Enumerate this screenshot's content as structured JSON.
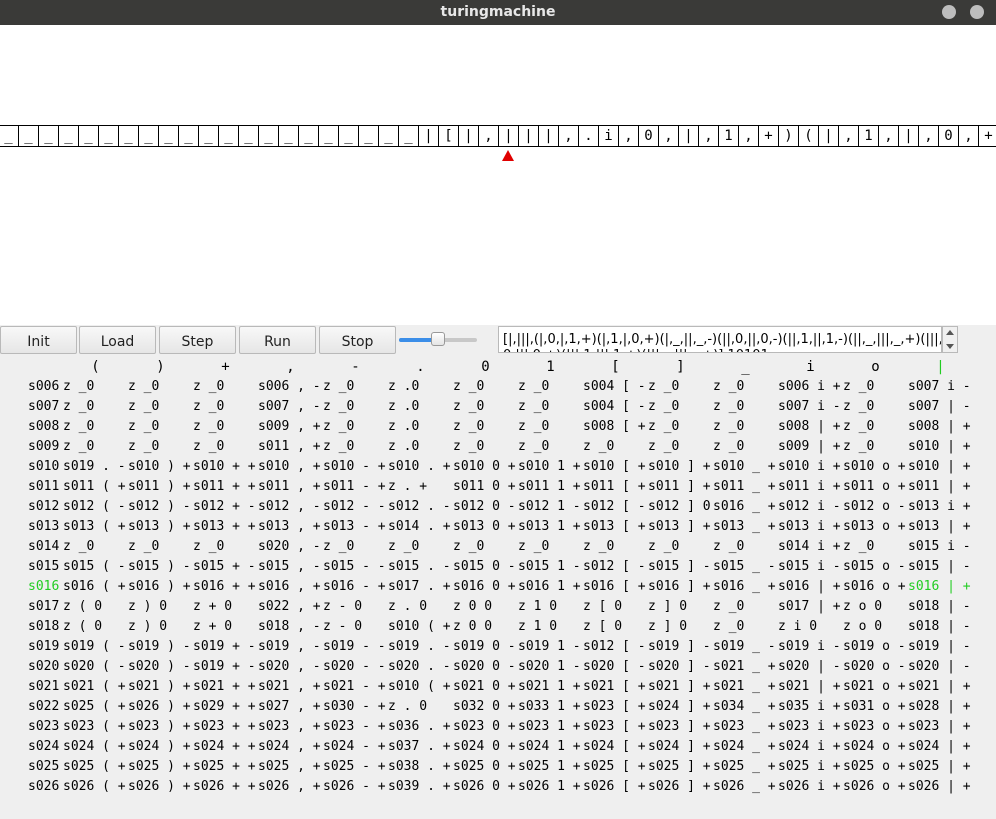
{
  "window": {
    "title": "turingmachine"
  },
  "tape": {
    "cells": [
      "_",
      "_",
      "_",
      "_",
      "_",
      "_",
      "_",
      "_",
      "_",
      "_",
      "_",
      "_",
      "_",
      "_",
      "_",
      "_",
      "_",
      "_",
      "_",
      "_",
      "_",
      "|",
      "[",
      "|",
      ",",
      "|",
      "|",
      "|",
      ",",
      ".",
      "i",
      ",",
      "0",
      ",",
      "|",
      ",",
      "1",
      ",",
      "+",
      ")",
      "(",
      "|",
      ",",
      "1",
      ",",
      "|",
      ",",
      "0",
      ",",
      "+"
    ],
    "head_index": 25
  },
  "toolbar": {
    "buttons": [
      "Init",
      "Load",
      "Step",
      "Run",
      "Stop"
    ],
    "speed_fraction": 0.5,
    "program_text": "[|,|||,(|,0,|,1,+)(|,1,|,0,+)(|,_,||,_,-)(||,0,||,0,-)(||,1,||,1,-)(||,_,|||,_,+)(|||,\n0,|||,0,+)(|||,1,|||,1,+)(|||,_,|||,_,+)] 10101"
  },
  "grid": {
    "headers": [
      "(",
      ")",
      "+",
      ",",
      "-",
      ".",
      "0",
      "1",
      "[",
      "]",
      "_",
      "i",
      "o",
      "|"
    ],
    "active_header_index": 13,
    "active_row_index": 10,
    "rows": [
      {
        "label": "s006",
        "cells": [
          "z _0",
          "z _0",
          "z _0",
          "s006 , -",
          "z _0",
          "z .0",
          "z _0",
          "z _0",
          "s004 [ -",
          "z _0",
          "z _0",
          "s006 i +",
          "z _0",
          "s007 i -"
        ]
      },
      {
        "label": "s007",
        "cells": [
          "z _0",
          "z _0",
          "z _0",
          "s007 , -",
          "z _0",
          "z .0",
          "z _0",
          "z _0",
          "s004 [ -",
          "z _0",
          "z _0",
          "s007 i -",
          "z _0",
          "s007 | -"
        ]
      },
      {
        "label": "s008",
        "cells": [
          "z _0",
          "z _0",
          "z _0",
          "s009 , +",
          "z _0",
          "z .0",
          "z _0",
          "z _0",
          "s008 [ +",
          "z _0",
          "z _0",
          "s008 | +",
          "z _0",
          "s008 | +"
        ]
      },
      {
        "label": "s009",
        "cells": [
          "z _0",
          "z _0",
          "z _0",
          "s011 , +",
          "z _0",
          "z .0",
          "z _0",
          "z _0",
          "z _0",
          "z _0",
          "z _0",
          "s009 | +",
          "z _0",
          "s010 | +"
        ]
      },
      {
        "label": "s010",
        "cells": [
          "s019 . -",
          "s010 ) +",
          "s010 + +",
          "s010 , +",
          "s010 - +",
          "s010 . +",
          "s010 0 +",
          "s010 1 +",
          "s010 [ +",
          "s010 ] +",
          "s010 _ +",
          "s010 i +",
          "s010 o +",
          "s010 | +"
        ]
      },
      {
        "label": "s011",
        "cells": [
          "s011 ( +",
          "s011 ) +",
          "s011 + +",
          "s011 , +",
          "s011 - +",
          "z . +",
          "s011 0 +",
          "s011 1 +",
          "s011 [ +",
          "s011 ] +",
          "s011 _ +",
          "s011 i +",
          "s011 o +",
          "s011 | +"
        ]
      },
      {
        "label": "s012",
        "cells": [
          "s012 ( -",
          "s012 ) -",
          "s012 + -",
          "s012 , -",
          "s012 - -",
          "s012 . -",
          "s012 0 -",
          "s012 1 -",
          "s012 [ -",
          "s012 ] 0",
          "s016 _ +",
          "s012 i -",
          "s012 o -",
          "s013 i +"
        ]
      },
      {
        "label": "s013",
        "cells": [
          "s013 ( +",
          "s013 ) +",
          "s013 + +",
          "s013 , +",
          "s013 - +",
          "s014 . +",
          "s013 0 +",
          "s013 1 +",
          "s013 [ +",
          "s013 ] +",
          "s013 _ +",
          "s013 i +",
          "s013 o +",
          "s013 | +"
        ]
      },
      {
        "label": "s014",
        "cells": [
          "z _0",
          "z _0",
          "z _0",
          "s020 , -",
          "z _0",
          "z _0",
          "z _0",
          "z _0",
          "z _0",
          "z _0",
          "z _0",
          "s014 i +",
          "z _0",
          "s015 i -"
        ]
      },
      {
        "label": "s015",
        "cells": [
          "s015 ( -",
          "s015 ) -",
          "s015 + -",
          "s015 , -",
          "s015 - -",
          "s015 . -",
          "s015 0 -",
          "s015 1 -",
          "s012 [ -",
          "s015 ] -",
          "s015 _ -",
          "s015 i -",
          "s015 o -",
          "s015 | -"
        ]
      },
      {
        "label": "s016",
        "cells": [
          "s016 ( +",
          "s016 ) +",
          "s016 + +",
          "s016 , +",
          "s016 - +",
          "s017 . +",
          "s016 0 +",
          "s016 1 +",
          "s016 [ +",
          "s016 ] +",
          "s016 _ +",
          "s016 | +",
          "s016 o +",
          "s016 | +"
        ]
      },
      {
        "label": "s017",
        "cells": [
          "z ( 0",
          "z ) 0",
          "z + 0",
          "s022 , +",
          "z - 0",
          "z . 0",
          "z 0 0",
          "z 1 0",
          "z [ 0",
          "z ] 0",
          "z _0",
          "s017 | +",
          "z o 0",
          "s018 | -"
        ]
      },
      {
        "label": "s018",
        "cells": [
          "z ( 0",
          "z ) 0",
          "z + 0",
          "s018 , -",
          "z - 0",
          "s010 ( +",
          "z 0 0",
          "z 1 0",
          "z [ 0",
          "z ] 0",
          "z _0",
          "z i 0",
          "z o 0",
          "s018 | -"
        ]
      },
      {
        "label": "s019",
        "cells": [
          "s019 ( -",
          "s019 ) -",
          "s019 + -",
          "s019 , -",
          "s019 - -",
          "s019 . -",
          "s019 0 -",
          "s019 1 -",
          "s012 [ -",
          "s019 ] -",
          "s019 _ -",
          "s019 i -",
          "s019 o -",
          "s019 | -"
        ]
      },
      {
        "label": "s020",
        "cells": [
          "s020 ( -",
          "s020 ) -",
          "s019 + -",
          "s020 , -",
          "s020 - -",
          "s020 . -",
          "s020 0 -",
          "s020 1 -",
          "s020 [ -",
          "s020 ] -",
          "s021 _ +",
          "s020 | -",
          "s020 o -",
          "s020 | -"
        ]
      },
      {
        "label": "s021",
        "cells": [
          "s021 ( +",
          "s021 ) +",
          "s021 + +",
          "s021 , +",
          "s021 - +",
          "s010 ( +",
          "s021 0 +",
          "s021 1 +",
          "s021 [ +",
          "s021 ] +",
          "s021 _ +",
          "s021 | +",
          "s021 o +",
          "s021 | +"
        ]
      },
      {
        "label": "s022",
        "cells": [
          "s025 ( +",
          "s026 ) +",
          "s029 + +",
          "s027 , +",
          "s030 - +",
          "z . 0",
          "s032 0 +",
          "s033 1 +",
          "s023 [ +",
          "s024 ] +",
          "s034 _ +",
          "s035 i +",
          "s031 o +",
          "s028 | +"
        ]
      },
      {
        "label": "s023",
        "cells": [
          "s023 ( +",
          "s023 ) +",
          "s023 + +",
          "s023 , +",
          "s023 - +",
          "s036 . +",
          "s023 0 +",
          "s023 1 +",
          "s023 [ +",
          "s023 ] +",
          "s023 _ +",
          "s023 i +",
          "s023 o +",
          "s023 | +"
        ]
      },
      {
        "label": "s024",
        "cells": [
          "s024 ( +",
          "s024 ) +",
          "s024 + +",
          "s024 , +",
          "s024 - +",
          "s037 . +",
          "s024 0 +",
          "s024 1 +",
          "s024 [ +",
          "s024 ] +",
          "s024 _ +",
          "s024 i +",
          "s024 o +",
          "s024 | +"
        ]
      },
      {
        "label": "s025",
        "cells": [
          "s025 ( +",
          "s025 ) +",
          "s025 + +",
          "s025 , +",
          "s025 - +",
          "s038 . +",
          "s025 0 +",
          "s025 1 +",
          "s025 [ +",
          "s025 ] +",
          "s025 _ +",
          "s025 i +",
          "s025 o +",
          "s025 | +"
        ]
      },
      {
        "label": "s026",
        "cells": [
          "s026 ( +",
          "s026 ) +",
          "s026 + +",
          "s026 , +",
          "s026 - +",
          "s039 . +",
          "s026 0 +",
          "s026 1 +",
          "s026 [ +",
          "s026 ] +",
          "s026 _ +",
          "s026 i +",
          "s026 o +",
          "s026 | +"
        ]
      }
    ]
  },
  "colors": {
    "highlight": "#22cc22",
    "head": "#e00000",
    "titlebar": "#3a3a38"
  }
}
